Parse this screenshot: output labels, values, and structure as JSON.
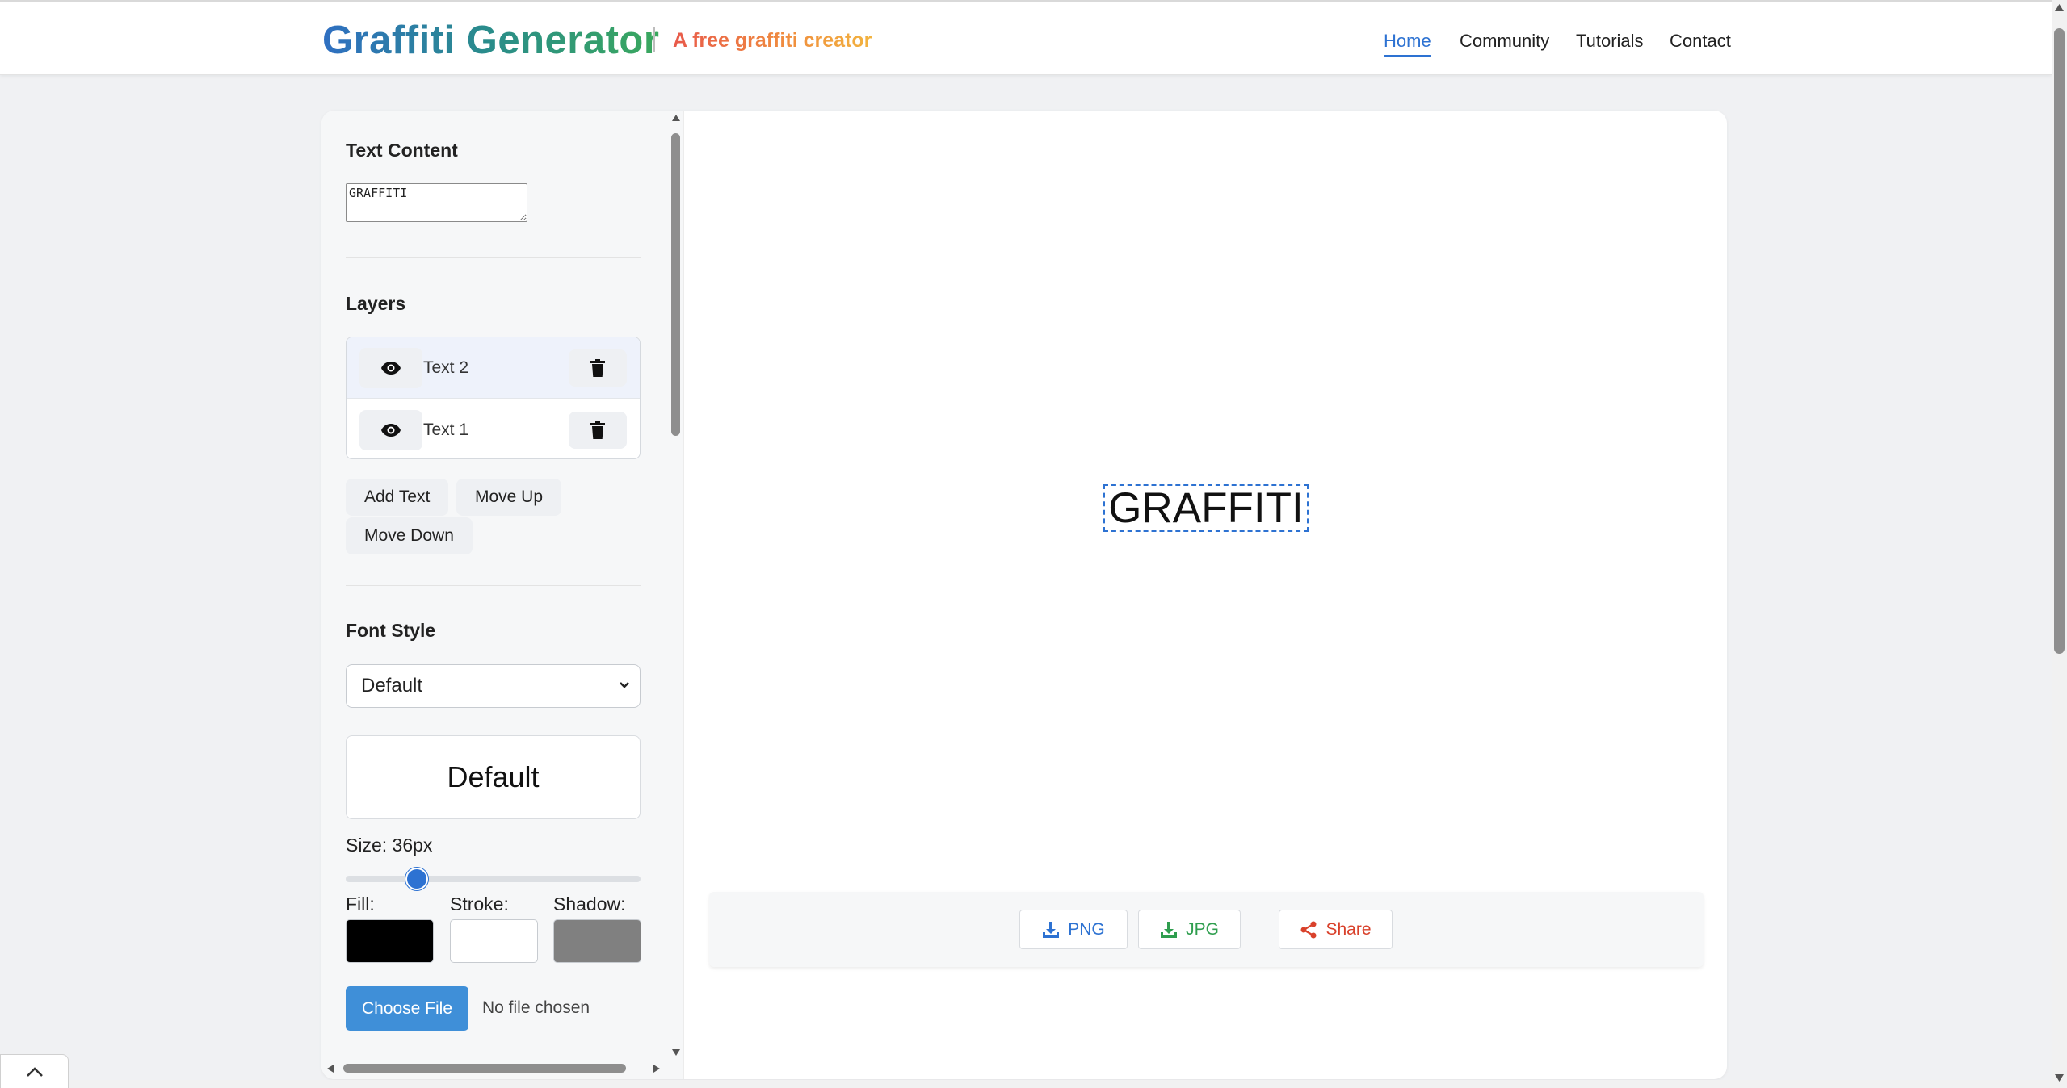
{
  "header": {
    "brand": "Graffiti Generator",
    "tagline": "A free graffiti creator",
    "nav": [
      {
        "label": "Home",
        "active": true
      },
      {
        "label": "Community",
        "active": false
      },
      {
        "label": "Tutorials",
        "active": false
      },
      {
        "label": "Contact",
        "active": false
      }
    ]
  },
  "sidebar": {
    "text_content": {
      "title": "Text Content",
      "value": "GRAFFITI"
    },
    "layers": {
      "title": "Layers",
      "items": [
        {
          "label": "Text 2",
          "selected": true,
          "visible_icon": "eye-icon",
          "delete_icon": "trash-icon"
        },
        {
          "label": "Text 1",
          "selected": false,
          "visible_icon": "eye-icon",
          "delete_icon": "trash-icon"
        }
      ],
      "actions": {
        "add_text": "Add Text",
        "move_up": "Move Up",
        "move_down": "Move Down"
      }
    },
    "font_style": {
      "title": "Font Style",
      "selected": "Default",
      "preview": "Default",
      "size_label": "Size: 36px",
      "size_value": 36
    },
    "colors": {
      "fill_label": "Fill:",
      "stroke_label": "Stroke:",
      "shadow_label": "Shadow:",
      "fill": "#000000",
      "stroke": "#ffffff",
      "shadow": "#808080"
    },
    "file": {
      "button": "Choose File",
      "status": "No file chosen"
    }
  },
  "canvas": {
    "text": "GRAFFITI"
  },
  "export": {
    "png": "PNG",
    "jpg": "JPG",
    "share": "Share",
    "png_color": "#2d72d2",
    "jpg_color": "#2f9e4f",
    "share_color": "#d9412b"
  }
}
